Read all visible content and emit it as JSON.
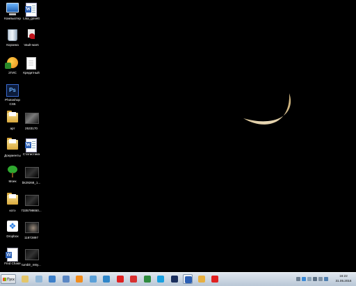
{
  "desktop": {
    "icons": [
      {
        "label": "Компьютер",
        "icon": "computer-icon"
      },
      {
        "label": "Lisa_govett",
        "icon": "word-document-icon"
      },
      {
        "label": "Корзина",
        "icon": "recycle-bin-icon"
      },
      {
        "label": "Vault-wars",
        "icon": "virus-document-icon"
      },
      {
        "label": "2ГИС",
        "icon": "2gis-icon"
      },
      {
        "label": "Кредитный",
        "icon": "text-document-icon"
      },
      {
        "label": "Photoshop CS5",
        "icon": "photoshop-icon"
      },
      {
        "label": "арт",
        "icon": "folder-icon"
      },
      {
        "label": "2533170",
        "icon": "image-thumbnail-icon"
      },
      {
        "label": "Документы",
        "icon": "folder-icon"
      },
      {
        "label": "Статистика",
        "icon": "word-document-icon"
      },
      {
        "label": "Моек",
        "icon": "tree-icon"
      },
      {
        "label": "bk29268_1...",
        "icon": "image-thumbnail-icon"
      },
      {
        "label": "котэ",
        "icon": "folder-icon"
      },
      {
        "label": "7335798650...",
        "icon": "image-thumbnail-icon"
      },
      {
        "label": "Dropbox",
        "icon": "dropbox-icon"
      },
      {
        "label": "11872897",
        "icon": "image-thumbnail-icon"
      },
      {
        "label": "Find Chase",
        "icon": "word-document-icon"
      },
      {
        "label": "tumblr_m6y...",
        "icon": "image-thumbnail-icon"
      }
    ]
  },
  "taskbar": {
    "start_label": "Пуск",
    "apps": [
      {
        "icon": "explorer-folder-icon",
        "color": "#e4c66a"
      },
      {
        "icon": "notepad-icon",
        "color": "#8fb6d8"
      },
      {
        "icon": "media-player-icon",
        "color": "#3c7fc9"
      },
      {
        "icon": "network-computer-icon",
        "color": "#5a87c4"
      },
      {
        "icon": "vlc-icon",
        "color": "#f28c1b"
      },
      {
        "icon": "image-viewer-icon",
        "color": "#5aa0d8"
      },
      {
        "icon": "sync-icon",
        "color": "#2f86c9"
      },
      {
        "icon": "yandex-browser-icon",
        "color": "#e02020"
      },
      {
        "icon": "yandex-icon",
        "color": "#d83030"
      },
      {
        "icon": "globe-icon",
        "color": "#2e8b3e"
      },
      {
        "icon": "skype-icon",
        "color": "#18a0e0"
      },
      {
        "icon": "photoshop-icon",
        "color": "#1b2f5e"
      },
      {
        "icon": "word-icon",
        "color": "#2b5fb4"
      },
      {
        "icon": "paint-icon",
        "color": "#e8b040"
      },
      {
        "icon": "yandex-browser-icon",
        "color": "#e02020"
      }
    ],
    "clock": {
      "time": "16:22",
      "date": "31.05.2016"
    }
  }
}
